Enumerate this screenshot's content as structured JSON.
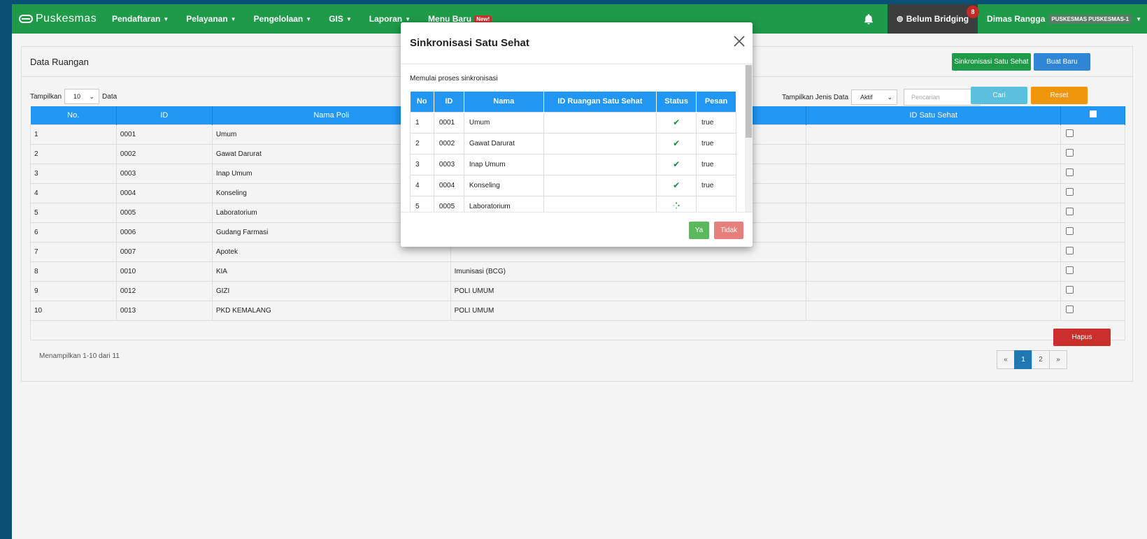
{
  "navbar": {
    "brand": "Puskesmas",
    "menus": [
      {
        "label": "Pendaftaran"
      },
      {
        "label": "Pelayanan"
      },
      {
        "label": "Pengelolaan"
      },
      {
        "label": "GIS"
      },
      {
        "label": "Laporan"
      }
    ],
    "menu_baru": "Menu Baru",
    "new_badge": "New!",
    "bridging_label": "Belum Bridging",
    "bridging_count": "8",
    "user_name": "Dimas Rangga",
    "user_unit": "PUSKESMAS PUSKESMAS-1"
  },
  "panel": {
    "title": "Data Ruangan",
    "sync_button": "Sinkronisasi Satu Sehat",
    "new_button": "Buat Baru",
    "tampilkan_label": "Tampilkan",
    "page_size": "10",
    "data_label": "Data",
    "jenis_label": "Tampilkan Jenis Data",
    "jenis_value": "Aktif",
    "search_placeholder": "Pencarian",
    "cari_button": "Cari",
    "reset_button": "Reset",
    "columns": [
      "No.",
      "ID",
      "Nama Poli",
      "",
      "ID Satu Sehat"
    ],
    "rows": [
      {
        "no": "1",
        "id": "0001",
        "nama": "Umum",
        "poli": ""
      },
      {
        "no": "2",
        "id": "0002",
        "nama": "Gawat Darurat",
        "poli": ""
      },
      {
        "no": "3",
        "id": "0003",
        "nama": "Inap Umum",
        "poli": ""
      },
      {
        "no": "4",
        "id": "0004",
        "nama": "Konseling",
        "poli": ""
      },
      {
        "no": "5",
        "id": "0005",
        "nama": "Laboratorium",
        "poli": ""
      },
      {
        "no": "6",
        "id": "0006",
        "nama": "Gudang Farmasi",
        "poli": ""
      },
      {
        "no": "7",
        "id": "0007",
        "nama": "Apotek",
        "poli": ""
      },
      {
        "no": "8",
        "id": "0010",
        "nama": "KIA",
        "poli": "Imunisasi (BCG)"
      },
      {
        "no": "9",
        "id": "0012",
        "nama": "GIZI",
        "poli": "POLI UMUM"
      },
      {
        "no": "10",
        "id": "0013",
        "nama": "PKD KEMALANG",
        "poli": "POLI UMUM"
      }
    ],
    "hapus_button": "Hapus",
    "showing_text": "Menampilkan 1-10 dari 11",
    "pager": {
      "prev": "«",
      "pages": [
        "1",
        "2"
      ],
      "next": "»",
      "active": "1"
    }
  },
  "modal": {
    "title": "Sinkronisasi Satu Sehat",
    "message": "Memulai proses sinkronisasi",
    "columns": [
      "No",
      "ID",
      "Nama",
      "ID Ruangan Satu Sehat",
      "Status",
      "Pesan"
    ],
    "rows": [
      {
        "no": "1",
        "id": "0001",
        "nama": "Umum",
        "id_satu_sehat": "",
        "status": "done",
        "pesan": "true"
      },
      {
        "no": "2",
        "id": "0002",
        "nama": "Gawat Darurat",
        "id_satu_sehat": "",
        "status": "done",
        "pesan": "true"
      },
      {
        "no": "3",
        "id": "0003",
        "nama": "Inap Umum",
        "id_satu_sehat": "",
        "status": "done",
        "pesan": "true"
      },
      {
        "no": "4",
        "id": "0004",
        "nama": "Konseling",
        "id_satu_sehat": "",
        "status": "done",
        "pesan": "true"
      },
      {
        "no": "5",
        "id": "0005",
        "nama": "Laboratorium",
        "id_satu_sehat": "",
        "status": "loading",
        "pesan": ""
      }
    ],
    "ya_button": "Ya",
    "tidak_button": "Tidak"
  },
  "colors": {
    "navbar": "#1f9a49",
    "table_header": "#2196f3",
    "page_background": "#0a4f74",
    "danger": "#c9302c",
    "warning": "#f0960b"
  }
}
